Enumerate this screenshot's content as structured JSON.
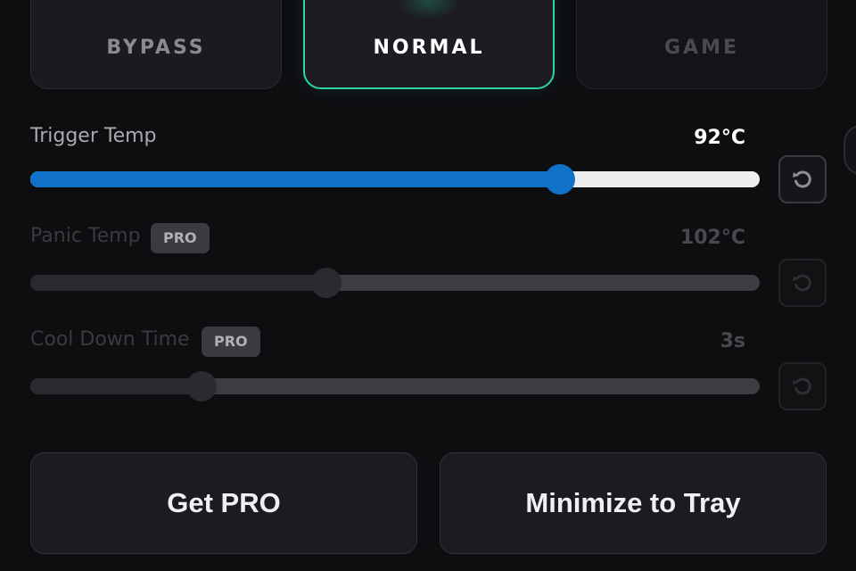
{
  "modes": {
    "bypass": {
      "label": "BYPASS"
    },
    "normal": {
      "label": "NORMAL",
      "selected": true,
      "icon": "shield-icon"
    },
    "game": {
      "label": "GAME"
    }
  },
  "settings": {
    "trigger_temp": {
      "label": "Trigger Temp",
      "value": "92°C",
      "fraction": 0.726,
      "enabled": true
    },
    "panic_temp": {
      "label": "Panic Temp",
      "badge": "PRO",
      "value": "102°C",
      "fraction": 0.406,
      "enabled": false
    },
    "cool_down_time": {
      "label": "Cool Down Time",
      "badge": "PRO",
      "value": "3s",
      "fraction": 0.235,
      "enabled": false
    }
  },
  "reset_icon": "reset-icon",
  "actions": {
    "get_pro": "Get PRO",
    "minimize_to_tray": "Minimize to Tray"
  },
  "colors": {
    "accent_green": "#2fd3a4",
    "slider_blue": "#0f72c8",
    "background": "#0e0e11"
  }
}
